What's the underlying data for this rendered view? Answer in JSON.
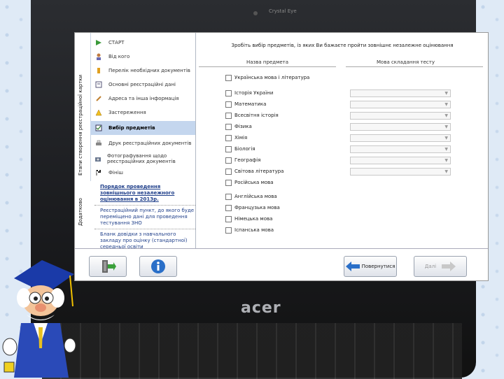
{
  "window": {
    "camera_label": "Crystal Eye"
  },
  "sidebar": {
    "vertical_main": "Етапи створення реєстраційної картки",
    "vertical_extra": "Додатково",
    "items": [
      {
        "label": "СТАРТ",
        "icon": "play-icon",
        "active": false
      },
      {
        "label": "Від кого",
        "icon": "person-icon",
        "active": false
      },
      {
        "label": "Перелік необхідних документів",
        "icon": "warning-icon",
        "active": false
      },
      {
        "label": "Основні реєстраційні дані",
        "icon": "edit-icon",
        "active": false
      },
      {
        "label": "Адреса та інша інформація",
        "icon": "pencil-icon",
        "active": false
      },
      {
        "label": "Застереження",
        "icon": "warning-icon",
        "active": false
      },
      {
        "label": "Вибір предметів",
        "icon": "checklist-icon",
        "active": true
      },
      {
        "label": "Друк реєстраційних документів",
        "icon": "printer-icon",
        "active": false
      },
      {
        "label": "Фотографування щодо реєстраційних документів",
        "icon": "camera-icon",
        "active": false
      },
      {
        "label": "Фініш",
        "icon": "flag-icon",
        "active": false
      }
    ],
    "info_links": [
      "Порядок проведення зовнішнього незалежного оцінювання в 2013р.",
      "Реєстраційний пункт, до якого буде переміщено дані для проведення тестування ЗНО",
      "Бланк довідки з навчального закладу про оцінку (стандартної) середньої освіти"
    ]
  },
  "main": {
    "title": "Зробіть вибір предметів, із яких Ви бажаєте пройти зовнішнє незалежне оцінювання",
    "col_subjects": "Назва предмета",
    "col_language": "Мова складання тесту",
    "subjects": [
      {
        "label": "Українська мова і література",
        "has_select": false
      },
      {
        "label": "Історія України",
        "has_select": true
      },
      {
        "label": "Математика",
        "has_select": true
      },
      {
        "label": "Всесвітня історія",
        "has_select": true
      },
      {
        "label": "Фізика",
        "has_select": true
      },
      {
        "label": "Хімія",
        "has_select": true
      },
      {
        "label": "Біологія",
        "has_select": true
      },
      {
        "label": "Географія",
        "has_select": true
      },
      {
        "label": "Світова література",
        "has_select": true
      },
      {
        "label": "Російська мова",
        "has_select": false
      },
      {
        "label": "Англійська мова",
        "has_select": false
      },
      {
        "label": "Французька мова",
        "has_select": false
      },
      {
        "label": "Німецька мова",
        "has_select": false
      },
      {
        "label": "Іспанська мова",
        "has_select": false
      }
    ]
  },
  "buttons": {
    "back_label": "Повернутися",
    "next_label": "Далі"
  },
  "laptop": {
    "brand": "acer"
  }
}
